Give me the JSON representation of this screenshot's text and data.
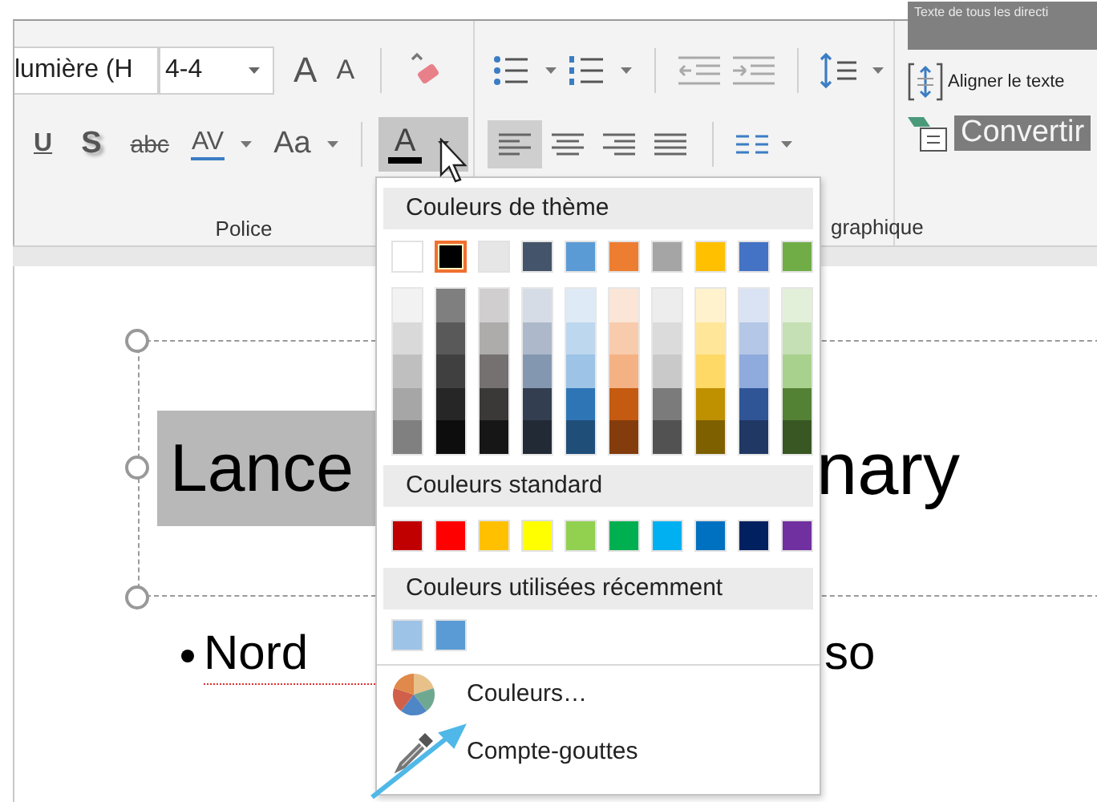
{
  "ribbon": {
    "font_group": {
      "font_name": "lumière (H",
      "font_size": "4-4",
      "grow_glyph": "A",
      "shrink_glyph": "A",
      "underline_glyph": "U",
      "shadow_glyph": "S",
      "strike_glyph": "abc",
      "spacing_glyph": "AV",
      "case_glyph": "Aa",
      "font_color_glyph": "A",
      "font_color_active": true,
      "label": "Police"
    },
    "paragraph_group": {
      "align_left_active": true,
      "label": "graphique"
    },
    "text_group": {
      "direction": "Texte de tous les directi",
      "align": "Aligner le texte",
      "convert": "Convertir"
    }
  },
  "slide": {
    "title_left": "Lance",
    "title_left_selected": true,
    "title_right": "nary",
    "bullet_left": "Nord",
    "bullet_left_misspelled": true,
    "bullet_right": "so"
  },
  "color_menu": {
    "theme_heading": "Couleurs de thème",
    "theme_colors": [
      {
        "color": "#ffffff",
        "selected": false
      },
      {
        "color": "#000000",
        "selected": true
      },
      {
        "color": "#e7e6e6",
        "selected": false
      },
      {
        "color": "#44546a",
        "selected": false
      },
      {
        "color": "#5b9bd5",
        "selected": false
      },
      {
        "color": "#ed7d31",
        "selected": false
      },
      {
        "color": "#a5a5a5",
        "selected": false
      },
      {
        "color": "#ffc000",
        "selected": false
      },
      {
        "color": "#4472c4",
        "selected": false
      },
      {
        "color": "#70ad47",
        "selected": false
      }
    ],
    "shade_columns": [
      {
        "shades": [
          {
            "color": "#f2f2f2"
          },
          {
            "color": "#d9d9d9"
          },
          {
            "color": "#bfbfbf"
          },
          {
            "color": "#a6a6a6"
          },
          {
            "color": "#808080"
          }
        ]
      },
      {
        "shades": [
          {
            "color": "#7f7f7f"
          },
          {
            "color": "#595959"
          },
          {
            "color": "#404040"
          },
          {
            "color": "#262626"
          },
          {
            "color": "#0d0d0d"
          }
        ]
      },
      {
        "shades": [
          {
            "color": "#d0cece"
          },
          {
            "color": "#aeabab"
          },
          {
            "color": "#767171"
          },
          {
            "color": "#3b3838"
          },
          {
            "color": "#171616"
          }
        ]
      },
      {
        "shades": [
          {
            "color": "#d6dce5"
          },
          {
            "color": "#adb9ca"
          },
          {
            "color": "#8497b0"
          },
          {
            "color": "#333f50"
          },
          {
            "color": "#222a35"
          }
        ]
      },
      {
        "shades": [
          {
            "color": "#deebf7"
          },
          {
            "color": "#bdd7ee"
          },
          {
            "color": "#9dc3e6"
          },
          {
            "color": "#2e75b6"
          },
          {
            "color": "#1f4e79"
          }
        ]
      },
      {
        "shades": [
          {
            "color": "#fbe5d6"
          },
          {
            "color": "#f8cbad"
          },
          {
            "color": "#f4b183"
          },
          {
            "color": "#c55a11"
          },
          {
            "color": "#843c0c"
          }
        ]
      },
      {
        "shades": [
          {
            "color": "#ededed"
          },
          {
            "color": "#dbdbdb"
          },
          {
            "color": "#c9c9c9"
          },
          {
            "color": "#7b7b7b"
          },
          {
            "color": "#525252"
          }
        ]
      },
      {
        "shades": [
          {
            "color": "#fff2cc"
          },
          {
            "color": "#ffe699"
          },
          {
            "color": "#ffd966"
          },
          {
            "color": "#bf9000"
          },
          {
            "color": "#7f6000"
          }
        ]
      },
      {
        "shades": [
          {
            "color": "#dae3f3"
          },
          {
            "color": "#b4c7e7"
          },
          {
            "color": "#8faadc"
          },
          {
            "color": "#2f5597"
          },
          {
            "color": "#203864"
          }
        ]
      },
      {
        "shades": [
          {
            "color": "#e2f0d9"
          },
          {
            "color": "#c5e0b4"
          },
          {
            "color": "#a9d18e"
          },
          {
            "color": "#548235"
          },
          {
            "color": "#385723"
          }
        ]
      }
    ],
    "standard_heading": "Couleurs standard",
    "standard_colors": [
      {
        "color": "#c00000"
      },
      {
        "color": "#ff0000"
      },
      {
        "color": "#ffc000"
      },
      {
        "color": "#ffff00"
      },
      {
        "color": "#92d050"
      },
      {
        "color": "#00b050"
      },
      {
        "color": "#00b0f0"
      },
      {
        "color": "#0070c0"
      },
      {
        "color": "#002060"
      },
      {
        "color": "#7030a0"
      }
    ],
    "recent_heading": "Couleurs utilisées récemment",
    "recent_colors": [
      {
        "color": "#9dc3e6"
      },
      {
        "color": "#5b9bd5"
      }
    ],
    "items": [
      {
        "kind": "palette",
        "label": "Couleurs…"
      },
      {
        "kind": "eyedropper",
        "label": "Compte-gouttes"
      }
    ]
  }
}
